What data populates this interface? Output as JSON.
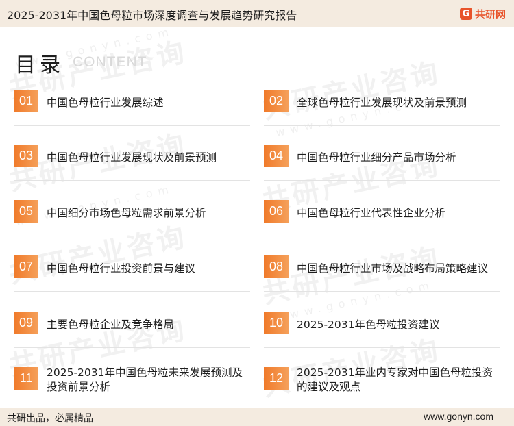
{
  "header": {
    "title": "2025-2031年中国色母粒市场深度调查与发展趋势研究报告",
    "logo_mark": "G",
    "logo_text": "共研网"
  },
  "toc": {
    "title": "目录",
    "subtitle": "CONTENT"
  },
  "watermark": {
    "text": "共研产业咨询",
    "url": "www.gonyn.com"
  },
  "items": [
    {
      "num": "01",
      "label": "中国色母粒行业发展综述"
    },
    {
      "num": "02",
      "label": "全球色母粒行业发展现状及前景预测"
    },
    {
      "num": "03",
      "label": "中国色母粒行业发展现状及前景预测"
    },
    {
      "num": "04",
      "label": "中国色母粒行业细分产品市场分析"
    },
    {
      "num": "05",
      "label": "中国细分市场色母粒需求前景分析"
    },
    {
      "num": "06",
      "label": "中国色母粒行业代表性企业分析"
    },
    {
      "num": "07",
      "label": "中国色母粒行业投资前景与建议"
    },
    {
      "num": "08",
      "label": "中国色母粒行业市场及战略布局策略建议"
    },
    {
      "num": "09",
      "label": "主要色母粒企业及竞争格局"
    },
    {
      "num": "10",
      "label": "2025-2031年色母粒投资建议"
    },
    {
      "num": "11",
      "label": "2025-2031年中国色母粒未来发展预测及投资前景分析"
    },
    {
      "num": "12",
      "label": "2025-2031年业内专家对中国色母粒投资的建议及观点"
    }
  ],
  "footer": {
    "left": "共研出品，必属精品",
    "right": "www.gonyn.com"
  },
  "colors": {
    "accent": "#f07a2a",
    "brand": "#e8532a",
    "band": "#f4ebe0"
  }
}
